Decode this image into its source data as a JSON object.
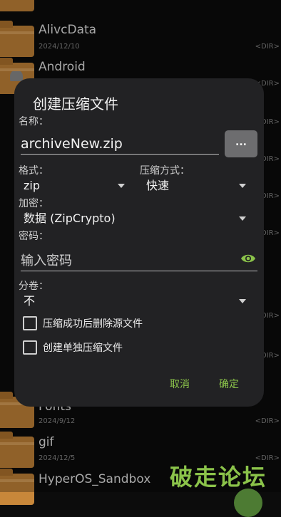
{
  "background_files": [
    {
      "name": "",
      "date": "",
      "dir": ""
    },
    {
      "name": "AlivcData",
      "date": "2024/12/10",
      "dir": "<DIR>"
    },
    {
      "name": "Android",
      "date": "",
      "dir": "<DIR>"
    },
    {
      "name": "",
      "date": "",
      "dir": "<DIR>"
    },
    {
      "name": "",
      "date": "",
      "dir": "<DIR>"
    },
    {
      "name": "",
      "date": "",
      "dir": "<DIR>"
    },
    {
      "name": "",
      "date": "",
      "dir": "<DIR>"
    },
    {
      "name": "",
      "date": "",
      "dir": "<DIR>"
    },
    {
      "name": "",
      "date": "",
      "dir": "<DIR>"
    },
    {
      "name": "Fonts",
      "date": "2024/9/12",
      "dir": "<DIR>"
    },
    {
      "name": "gif",
      "date": "2024/12/5",
      "dir": "<DIR>"
    },
    {
      "name": "HyperOS_Sandbox",
      "date": "",
      "dir": ""
    }
  ],
  "dialog": {
    "title": "创建压缩文件",
    "name_label": "名称：",
    "name_value": "archiveNew.zip",
    "browse_label": "...",
    "format_label": "格式：",
    "format_value": "zip",
    "method_label": "压缩方式：",
    "method_value": "快速",
    "encrypt_label": "加密：",
    "encrypt_value": "数据 (ZipCrypto)",
    "password_label": "密码：",
    "password_placeholder": "输入密码",
    "split_label": "分卷：",
    "split_value": "不",
    "delete_source_label": "压缩成功后删除源文件",
    "separate_label": "创建单独压缩文件",
    "cancel_label": "取消",
    "ok_label": "确定"
  },
  "watermark": "破走论坛",
  "colors": {
    "accent": "#8bc34a",
    "folder": "#c8873a",
    "dialog_bg": "#222224"
  }
}
